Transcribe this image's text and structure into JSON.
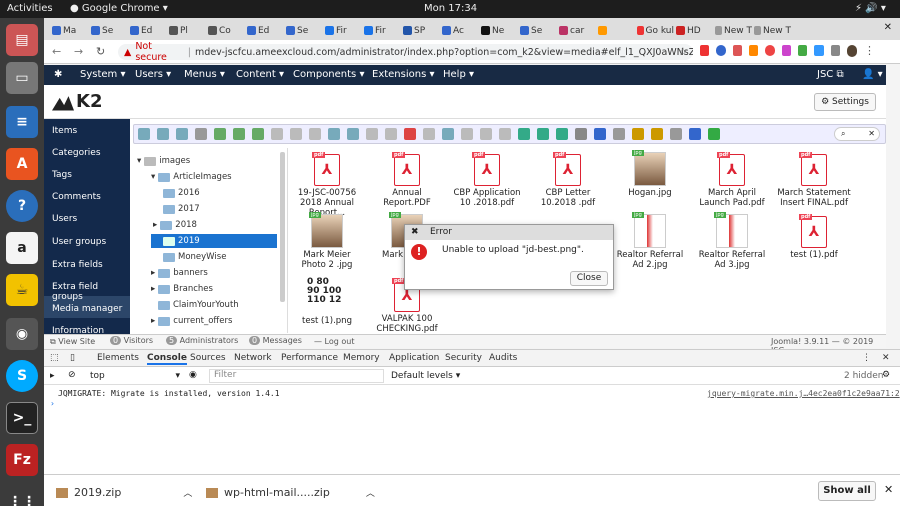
{
  "os": {
    "activities": "Activities",
    "app": "Google Chrome",
    "clock": "Mon 17:34"
  },
  "tabs": [
    "Ma",
    "Se",
    "Ed",
    "Pl",
    "Co",
    "Ed",
    "Se",
    "Fir",
    "Fir",
    "SP",
    "Ac",
    "Ne",
    "Se",
    "car",
    "",
    "Go kul",
    "HD",
    "New T",
    "New T"
  ],
  "address": {
    "security": "Not secure",
    "url": "mdev-jscfcu.ameexcloud.com/administrator/index.php?option=com_k2&view=media#elf_l1_QXJ0aWNsZUltY..."
  },
  "joomla_nav": {
    "menus": [
      "System ▾",
      "Users ▾",
      "Menus ▾",
      "Content ▾",
      "Components ▾",
      "Extensions ▾",
      "Help ▾"
    ],
    "site": "JSC ⧉",
    "user": "👤 ▾"
  },
  "header": {
    "logo": "K2",
    "settings": "Settings"
  },
  "sidebar": [
    "Items",
    "Categories",
    "Tags",
    "Comments",
    "Users",
    "User groups",
    "Extra fields",
    "Extra field groups",
    "Media manager",
    "Information"
  ],
  "tree": {
    "root": "images",
    "items": [
      "ArticleImages",
      "2016",
      "2017",
      "2018",
      "2019",
      "MoneyWise",
      "banners",
      "Branches",
      "ClaimYourYouth",
      "current_offers"
    ]
  },
  "files": [
    {
      "name": "19-JSC-00756 2018 Annual Report...",
      "kind": "pdf"
    },
    {
      "name": "Annual Report.PDF",
      "kind": "pdf"
    },
    {
      "name": "CBP Application 10 .2018.pdf",
      "kind": "pdf"
    },
    {
      "name": "CBP Letter 10.2018 .pdf",
      "kind": "pdf"
    },
    {
      "name": "Hogan.jpg",
      "kind": "jpg"
    },
    {
      "name": "March April Launch Pad.pdf",
      "kind": "pdf"
    },
    {
      "name": "March Statement Insert FINAL.pdf",
      "kind": "pdf"
    },
    {
      "name": "Mark Meier Photo 2 .jpg",
      "kind": "jpg"
    },
    {
      "name": "Mark M 175",
      "kind": "jpg"
    },
    {
      "name": "Realtor Referral Ad 2.jpg",
      "kind": "jpg"
    },
    {
      "name": "Realtor Referral Ad 3.jpg",
      "kind": "jpg"
    },
    {
      "name": "test (1).pdf",
      "kind": "pdf"
    },
    {
      "name": "test (1).png",
      "kind": "png"
    },
    {
      "name": "VALPAK 100 CHECKING.pdf",
      "kind": "pdf"
    }
  ],
  "png_text": "0 80\n90 100\n110 12",
  "dialog": {
    "title": "Error",
    "message": "Unable to upload \"jd-best.png\".",
    "close": "Close"
  },
  "status": {
    "view_site": "View Site",
    "visitors_count": "0",
    "visitors": "Visitors",
    "admins_count": "5",
    "admins": "Administrators",
    "msgs_count": "0",
    "messages": "Messages",
    "logout": "Log out",
    "version": "Joomla! 3.9.11 — © 2019 JSC"
  },
  "devtools": {
    "tabs": [
      "Elements",
      "Console",
      "Sources",
      "Network",
      "Performance",
      "Memory",
      "Application",
      "Security",
      "Audits"
    ],
    "context": "top",
    "filter": "Filter",
    "levels": "Default levels ▾",
    "hidden": "2 hidden",
    "log": "JQMIGRATE: Migrate is installed, version 1.4.1",
    "source": "jquery-migrate.min.j…4ec2ea0f1c2e9aa71:2",
    "prompt": "›"
  },
  "downloads": [
    {
      "name": "2019.zip"
    },
    {
      "name": "wp-html-mail.....zip"
    }
  ],
  "show_all": "Show all"
}
